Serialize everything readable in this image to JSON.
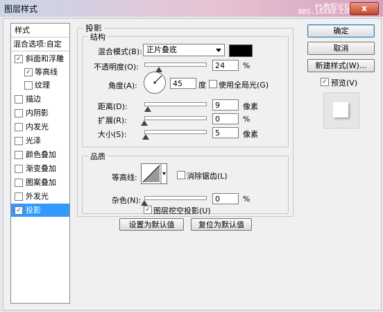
{
  "window": {
    "title": "图层样式",
    "watermark_line1": "PS教程论坛",
    "watermark_line2": "BBS.16XX8.COM",
    "close_glyph": "x"
  },
  "stylelist": {
    "header": "样式",
    "blend_options": "混合选项:自定",
    "items": [
      {
        "label": "斜面和浮雕",
        "checked": "✓"
      },
      {
        "label": "等高线",
        "checked": "✓"
      },
      {
        "label": "纹理",
        "checked": ""
      },
      {
        "label": "描边",
        "checked": ""
      },
      {
        "label": "内阴影",
        "checked": ""
      },
      {
        "label": "内发光",
        "checked": ""
      },
      {
        "label": "光泽",
        "checked": ""
      },
      {
        "label": "颜色叠加",
        "checked": ""
      },
      {
        "label": "渐变叠加",
        "checked": ""
      },
      {
        "label": "图案叠加",
        "checked": ""
      },
      {
        "label": "外发光",
        "checked": ""
      },
      {
        "label": "投影",
        "checked": "✓"
      }
    ]
  },
  "panel": {
    "title": "投影",
    "structure": {
      "legend": "结构",
      "blend_mode_label": "混合模式(B):",
      "blend_mode_value": "正片叠底",
      "opacity_label": "不透明度(O):",
      "opacity_value": "24",
      "opacity_unit": "%",
      "opacity_level": 24,
      "angle_label": "角度(A):",
      "angle_value": "45",
      "angle_unit": "度",
      "global_light_label": "使用全局光(G)",
      "distance_label": "距离(D):",
      "distance_value": "9",
      "distance_unit": "像素",
      "spread_label": "扩展(R):",
      "spread_value": "0",
      "spread_unit": "%",
      "size_label": "大小(S):",
      "size_value": "5",
      "size_unit": "像素"
    },
    "quality": {
      "legend": "品质",
      "contour_label": "等高线:",
      "antialias_label": "消除锯齿(L)",
      "noise_label": "杂色(N):",
      "noise_value": "0",
      "noise_unit": "%"
    },
    "knockout_label": "图层挖空投影(U)",
    "knockout_check": "✓",
    "make_default_label": "设置为默认值",
    "reset_default_label": "复位为默认值"
  },
  "buttons": {
    "ok": "确定",
    "cancel": "取消",
    "new_style": "新建样式(W)..."
  },
  "preview": {
    "label": "预览(V)",
    "check": "✓"
  },
  "colors": {
    "shadow_color": "#000000",
    "selected_item": "#3399ff"
  }
}
